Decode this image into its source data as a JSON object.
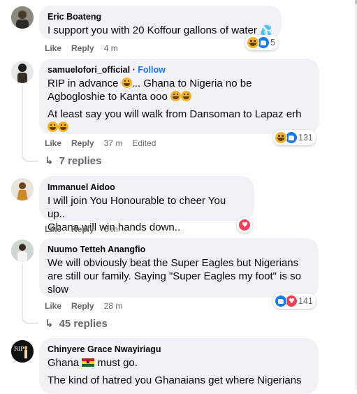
{
  "comments": [
    {
      "author": "Eric Boateng",
      "lines": [
        "I support you with 20 Koffour gallons of water"
      ],
      "time": "4 m",
      "reaction_count": "5",
      "reactions": [
        "haha",
        "like"
      ]
    },
    {
      "author": "samuelofori_official",
      "separator": "·",
      "follow": "Follow",
      "lines": [
        "RIP in advance",
        "... Ghana to Nigeria no be Agbogloshie to Kanta ooo",
        "At least say you will walk from Dansoman to Lapaz erh"
      ],
      "time": "37 m",
      "edited": "Edited",
      "reaction_count": "131",
      "replies": "7 replies"
    },
    {
      "author": "Immanuel Aidoo",
      "lines": [
        "I will join You Honourable to cheer You up..",
        "Ghana will win hands down.."
      ],
      "time": "6 m",
      "reactions": [
        "love"
      ]
    },
    {
      "author": "Nuumo Tetteh Anangfio",
      "lines": [
        "We will obviously beat the Super Eagles but Nigerians are still our family. Saying \"Super Eagles my foot\" is so slow"
      ],
      "time": "28 m",
      "reaction_count": "141",
      "replies": "45 replies"
    },
    {
      "author": "Chinyere Grace Nwayiriagu",
      "lines": [
        "Ghana",
        "must go.",
        "The kind of hatred you Ghanaians get where Nigerians"
      ]
    }
  ],
  "actions": {
    "like": "Like",
    "reply": "Reply"
  },
  "avatar_texts": {
    "rip": "RIP"
  },
  "colors": {
    "bubble": "#f0f2f5",
    "link": "#1877f2",
    "meta": "#65676b"
  }
}
